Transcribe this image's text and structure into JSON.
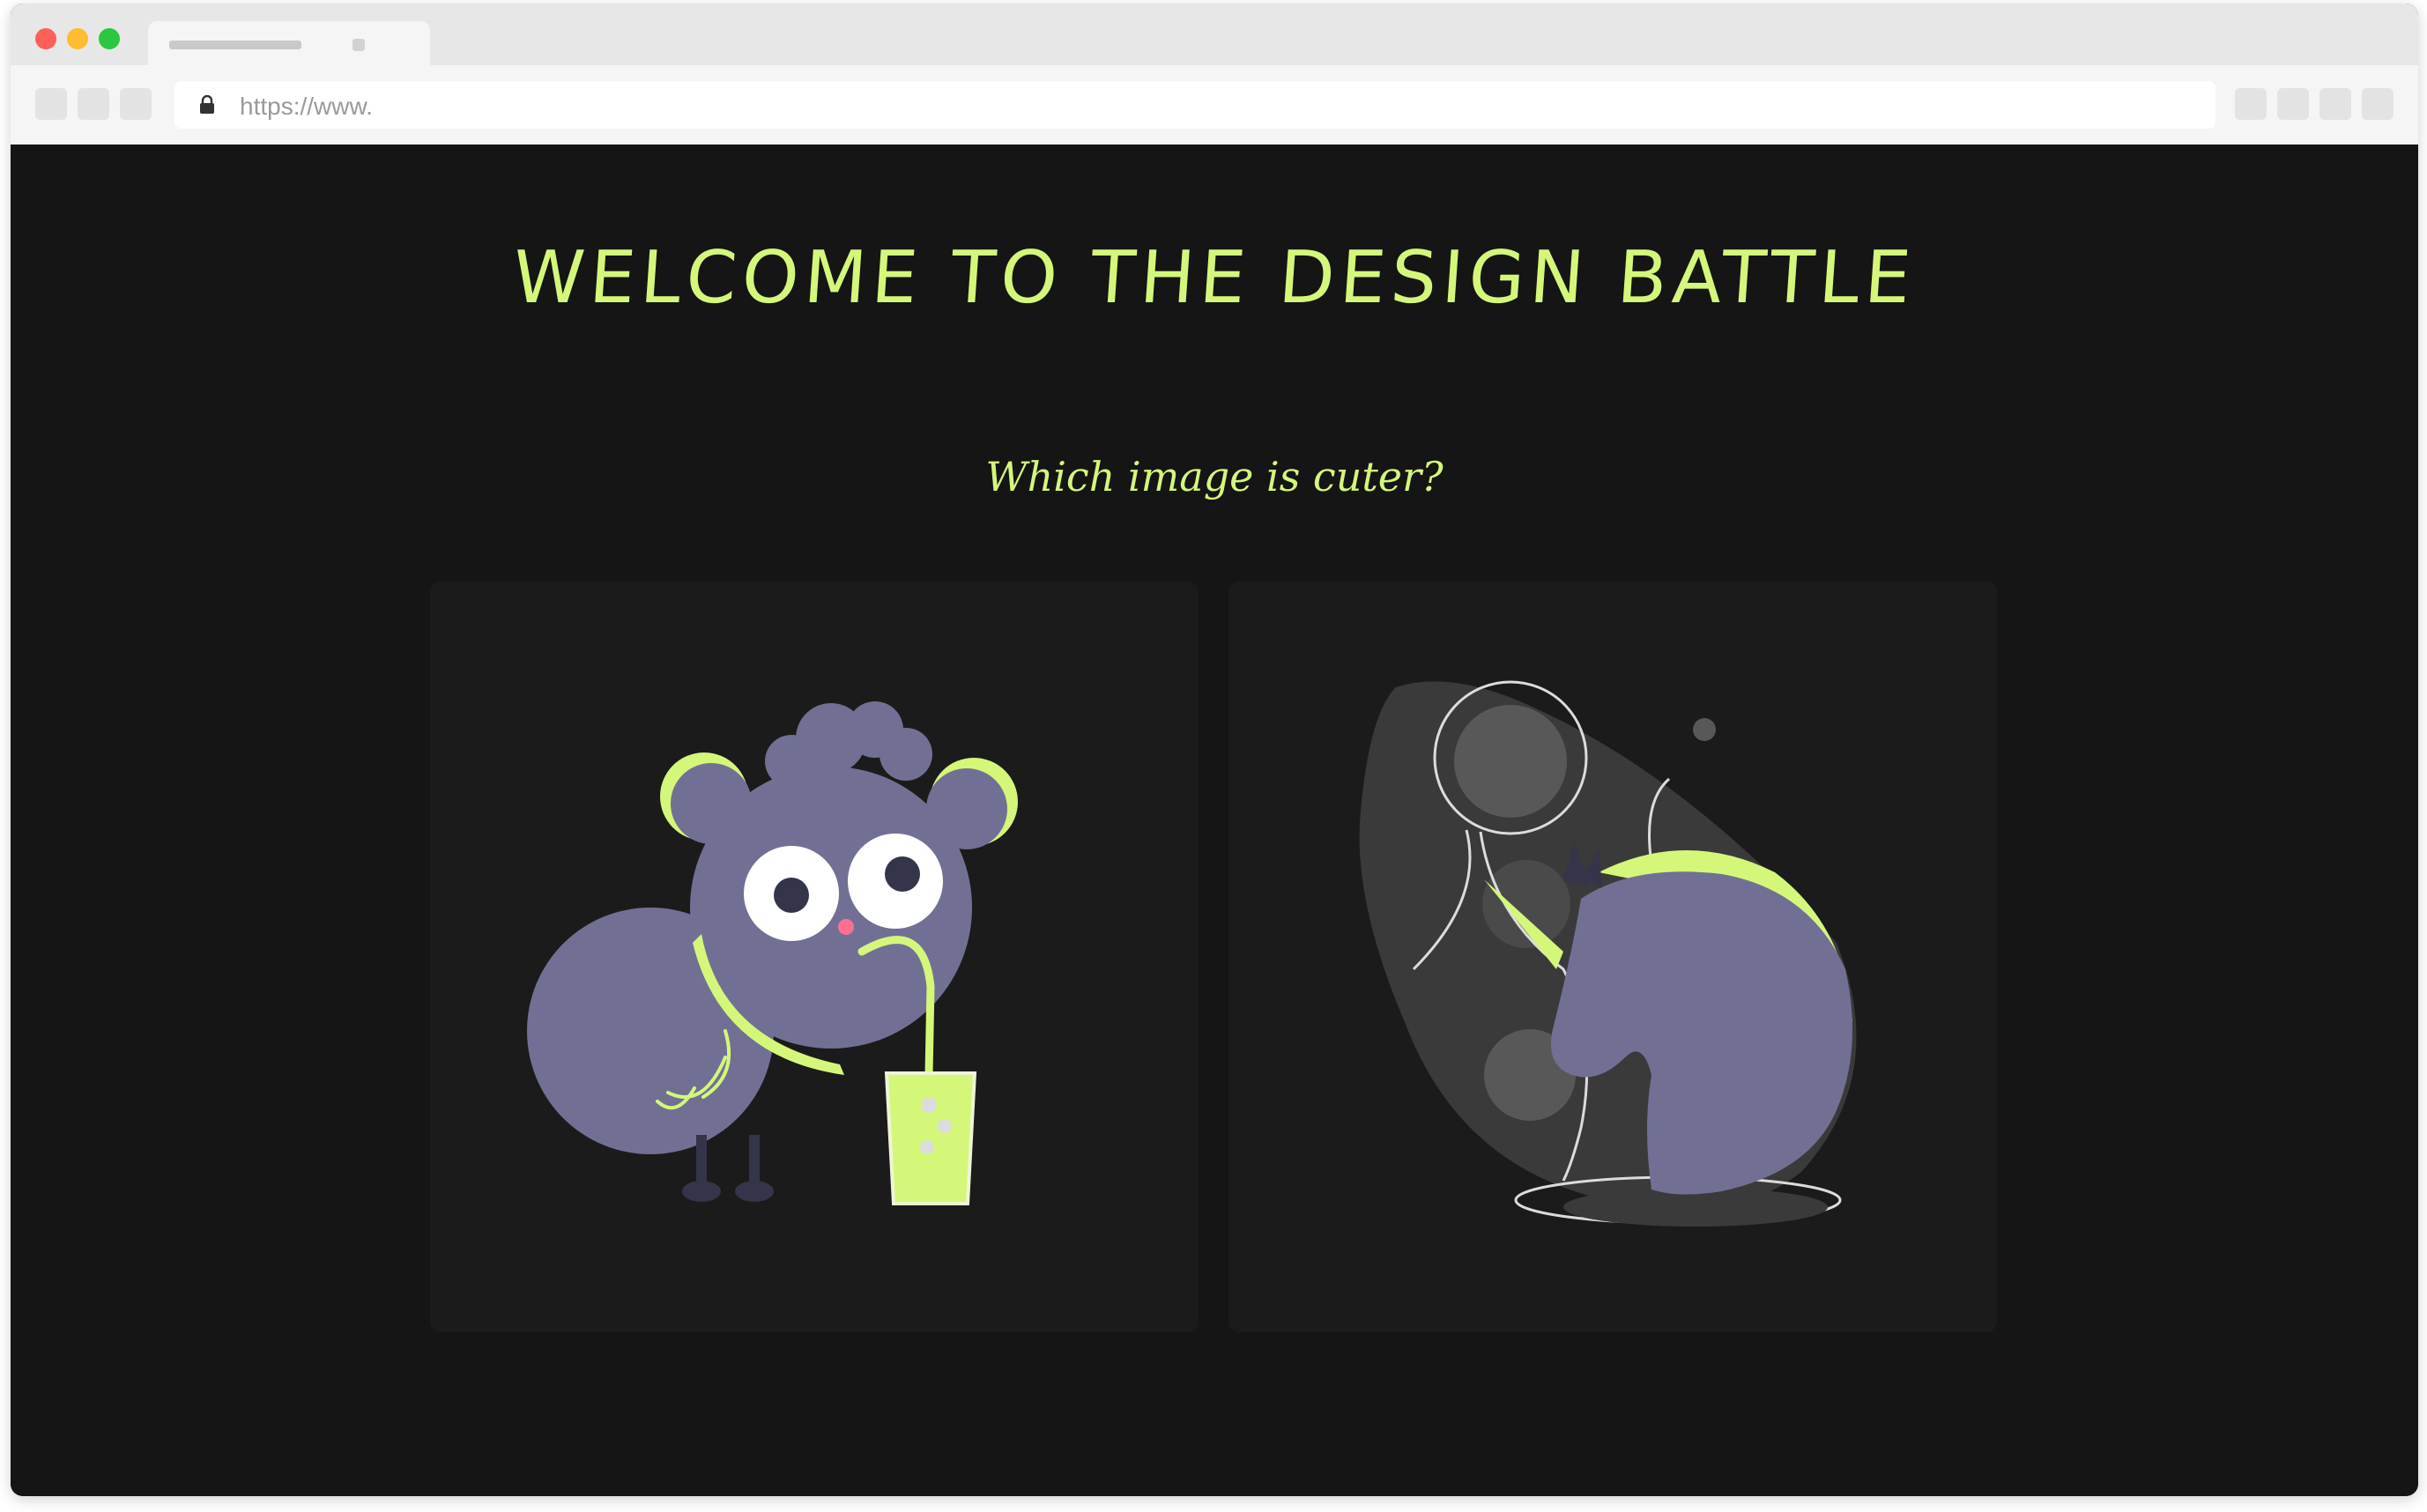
{
  "browser": {
    "url": "https://www."
  },
  "page": {
    "heading": "WELCOME TO THE DESIGN BATTLE",
    "question": "Which image is cuter?"
  },
  "options": [
    {
      "illustration": "creature-drinking-icon"
    },
    {
      "illustration": "unicorn-icon"
    }
  ],
  "colors": {
    "accent": "#d4f77a",
    "background": "#151515",
    "card": "#1b1b1b",
    "character": "#717094"
  }
}
